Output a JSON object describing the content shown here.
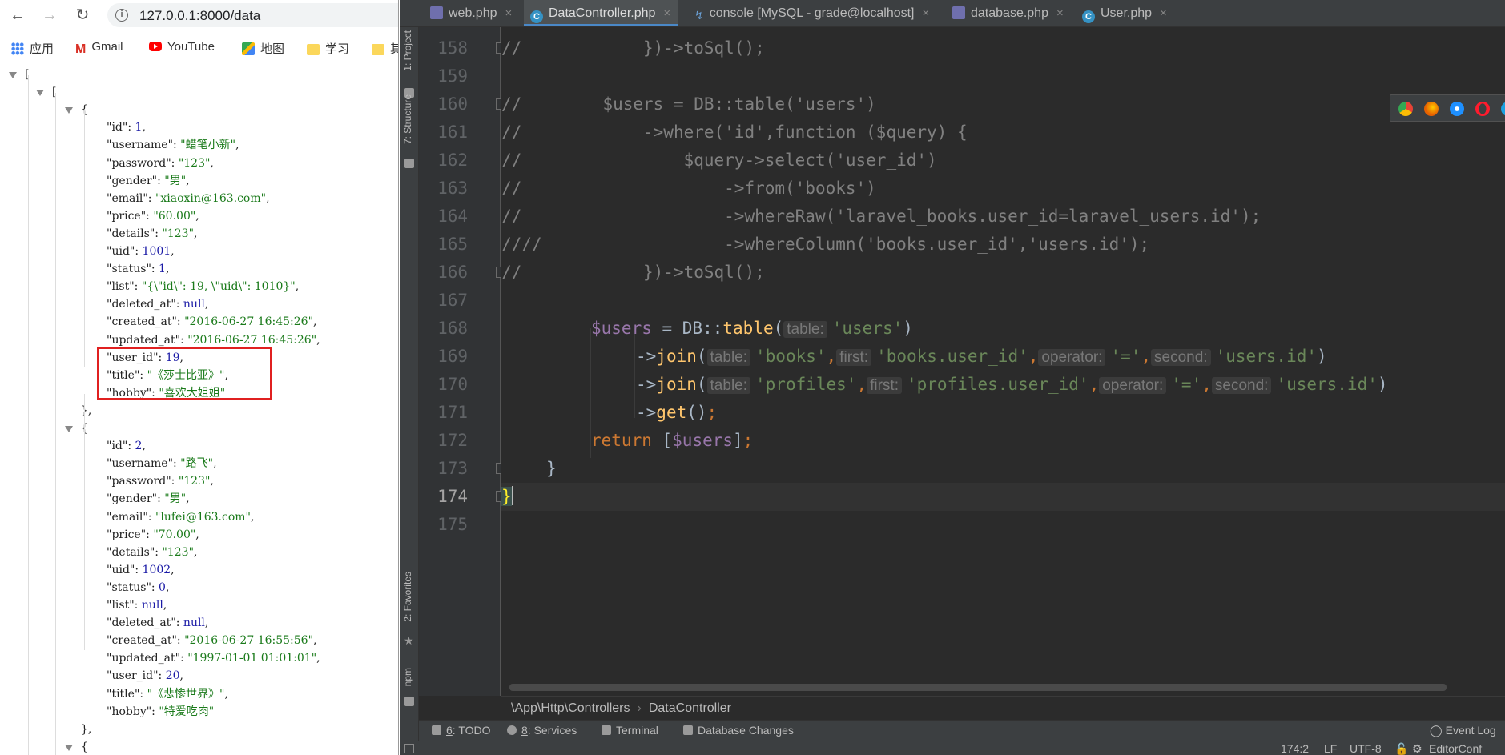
{
  "browser": {
    "url": "127.0.0.1:8000/data",
    "bookmarks": [
      "应用",
      "Gmail",
      "YouTube",
      "地图",
      "学习",
      "其"
    ],
    "json_lines": [
      {
        "indent": 0,
        "text": "[",
        "fold": true
      },
      {
        "indent": 1,
        "text": "[",
        "fold": true
      },
      {
        "indent": 2,
        "text": "{",
        "fold": true
      },
      {
        "indent": 3,
        "key": "id",
        "val": "1",
        "type": "n"
      },
      {
        "indent": 3,
        "key": "username",
        "val": "\"蜡笔小新\"",
        "type": "s"
      },
      {
        "indent": 3,
        "key": "password",
        "val": "\"123\"",
        "type": "s"
      },
      {
        "indent": 3,
        "key": "gender",
        "val": "\"男\"",
        "type": "s"
      },
      {
        "indent": 3,
        "key": "email",
        "val": "\"xiaoxin@163.com\"",
        "type": "s"
      },
      {
        "indent": 3,
        "key": "price",
        "val": "\"60.00\"",
        "type": "s"
      },
      {
        "indent": 3,
        "key": "details",
        "val": "\"123\"",
        "type": "s"
      },
      {
        "indent": 3,
        "key": "uid",
        "val": "1001",
        "type": "n"
      },
      {
        "indent": 3,
        "key": "status",
        "val": "1",
        "type": "n"
      },
      {
        "indent": 3,
        "key": "list",
        "val": "\"{\\\"id\\\": 19, \\\"uid\\\": 1010}\"",
        "type": "s"
      },
      {
        "indent": 3,
        "key": "deleted_at",
        "val": "null",
        "type": "nl"
      },
      {
        "indent": 3,
        "key": "created_at",
        "val": "\"2016-06-27 16:45:26\"",
        "type": "s"
      },
      {
        "indent": 3,
        "key": "updated_at",
        "val": "\"2016-06-27 16:45:26\"",
        "type": "s"
      },
      {
        "indent": 3,
        "key": "user_id",
        "val": "19",
        "type": "n"
      },
      {
        "indent": 3,
        "key": "title",
        "val": "\"《莎士比亚》\"",
        "type": "s"
      },
      {
        "indent": 3,
        "key": "hobby",
        "val": "\"喜欢大姐姐\"",
        "type": "s",
        "last": true
      },
      {
        "indent": 2,
        "text": "},"
      },
      {
        "indent": 2,
        "text": "{",
        "fold": true
      },
      {
        "indent": 3,
        "key": "id",
        "val": "2",
        "type": "n"
      },
      {
        "indent": 3,
        "key": "username",
        "val": "\"路飞\"",
        "type": "s"
      },
      {
        "indent": 3,
        "key": "password",
        "val": "\"123\"",
        "type": "s"
      },
      {
        "indent": 3,
        "key": "gender",
        "val": "\"男\"",
        "type": "s"
      },
      {
        "indent": 3,
        "key": "email",
        "val": "\"lufei@163.com\"",
        "type": "s"
      },
      {
        "indent": 3,
        "key": "price",
        "val": "\"70.00\"",
        "type": "s"
      },
      {
        "indent": 3,
        "key": "details",
        "val": "\"123\"",
        "type": "s"
      },
      {
        "indent": 3,
        "key": "uid",
        "val": "1002",
        "type": "n"
      },
      {
        "indent": 3,
        "key": "status",
        "val": "0",
        "type": "n"
      },
      {
        "indent": 3,
        "key": "list",
        "val": "null",
        "type": "nl"
      },
      {
        "indent": 3,
        "key": "deleted_at",
        "val": "null",
        "type": "nl"
      },
      {
        "indent": 3,
        "key": "created_at",
        "val": "\"2016-06-27 16:55:56\"",
        "type": "s"
      },
      {
        "indent": 3,
        "key": "updated_at",
        "val": "\"1997-01-01 01:01:01\"",
        "type": "s"
      },
      {
        "indent": 3,
        "key": "user_id",
        "val": "20",
        "type": "n"
      },
      {
        "indent": 3,
        "key": "title",
        "val": "\"《悲惨世界》\"",
        "type": "s"
      },
      {
        "indent": 3,
        "key": "hobby",
        "val": "\"特爱吃肉\"",
        "type": "s",
        "last": true
      },
      {
        "indent": 2,
        "text": "},"
      },
      {
        "indent": 2,
        "text": "{",
        "fold": true
      }
    ]
  },
  "ide": {
    "tabs": [
      {
        "label": "web.php",
        "icon": "php-file-icon",
        "active": false
      },
      {
        "label": "DataController.php",
        "icon": "class-icon",
        "active": true
      },
      {
        "label": "console [MySQL - grade@localhost]",
        "icon": "console-icon",
        "active": false
      },
      {
        "label": "database.php",
        "icon": "php-file-icon",
        "active": false
      },
      {
        "label": "User.php",
        "icon": "class-icon",
        "active": false
      }
    ],
    "tool_windows_left": [
      "1: Project",
      "7: Structure",
      "2: Favorites",
      "npm"
    ],
    "line_numbers": [
      "158",
      "159",
      "160",
      "161",
      "162",
      "163",
      "164",
      "165",
      "166",
      "167",
      "168",
      "169",
      "170",
      "171",
      "172",
      "173",
      "174",
      "175"
    ],
    "current_line": "174",
    "code": {
      "l158": {
        "c": "//",
        "rest": "            })->toSql();"
      },
      "l160": {
        "c": "//",
        "rest": "        $users = DB::table('users')"
      },
      "l161": {
        "c": "//",
        "rest": "            ->where('id',function ($query) {"
      },
      "l162": {
        "c": "//",
        "rest": "                $query->select('user_id')"
      },
      "l163": {
        "c": "//",
        "rest": "                    ->from('books')"
      },
      "l164": {
        "c": "//",
        "rest": "                    ->whereRaw('laravel_books.user_id=laravel_users.id');"
      },
      "l165": {
        "c": "////",
        "rest": "                  ->whereColumn('books.user_id','users.id');"
      },
      "l166": {
        "c": "//",
        "rest": "            })->toSql();"
      },
      "l168": {
        "var": "$users",
        "eq": " = DB::",
        "fn": "table",
        "open": "(",
        "h1": "table:",
        "s1": "'users'",
        "close": ")"
      },
      "l169": {
        "arrow": "->",
        "fn": "join",
        "open": "(",
        "h1": "table:",
        "s1": "'books'",
        "h2": "first:",
        "s2": "'books.user_id'",
        "h3": "operator:",
        "s3": "'='",
        "h4": "second:",
        "s4": "'users.id'",
        "close": ")",
        "comma": ","
      },
      "l170": {
        "arrow": "->",
        "fn": "join",
        "open": "(",
        "h1": "table:",
        "s1": "'profiles'",
        "h2": "first:",
        "s2": "'profiles.user_id'",
        "h3": "operator:",
        "s3": "'='",
        "h4": "second:",
        "s4": "'users.id'",
        "close": ")",
        "comma": ","
      },
      "l171": {
        "arrow": "->",
        "fn": "get",
        "tail": "()",
        "semi": ";"
      },
      "l172": {
        "kw": "return",
        "open": " [",
        "var": "$users",
        "close": "]",
        "semi": ";"
      },
      "l173": {
        "text": "}"
      },
      "l174": {
        "text": "}"
      }
    },
    "breadcrumb": [
      "\\App\\Http\\Controllers",
      "DataController"
    ],
    "bottom_tools": [
      {
        "num": "6",
        "label": ": TODO"
      },
      {
        "num": "8",
        "label": ": Services"
      },
      {
        "num": "",
        "label": "Terminal"
      },
      {
        "num": "",
        "label": "Database Changes"
      }
    ],
    "event_log": "Event Log",
    "status": {
      "position": "174:2",
      "line_sep": "LF",
      "encoding": "UTF-8",
      "editorconfig": "EditorConf"
    },
    "colors": {
      "background": "#2b2b2b",
      "comment": "#808080",
      "string": "#6a8759",
      "variable": "#9876aa",
      "function": "#ffc66d",
      "keyword": "#cc7832",
      "highlight_box": "#e02020"
    }
  }
}
